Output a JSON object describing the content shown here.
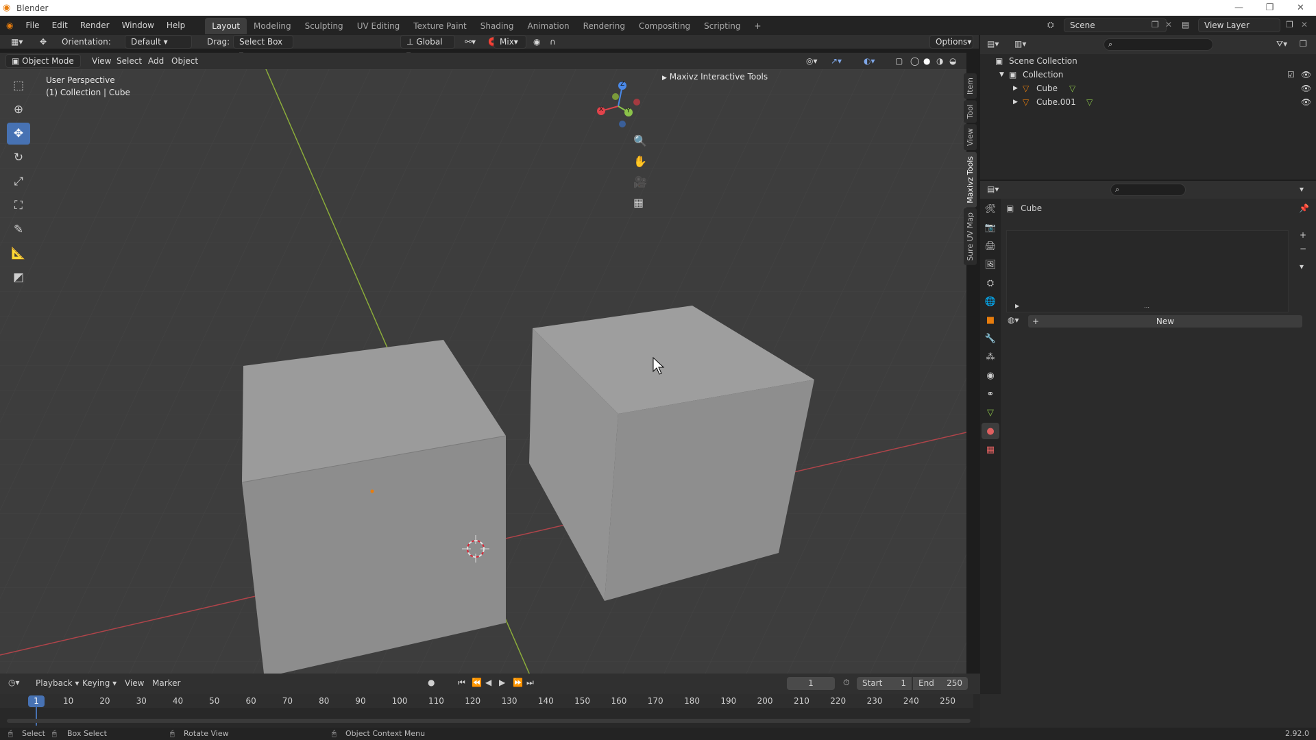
{
  "window": {
    "title": "Blender"
  },
  "menu": [
    "File",
    "Edit",
    "Render",
    "Window",
    "Help"
  ],
  "workspaces": [
    "Layout",
    "Modeling",
    "Sculpting",
    "UV Editing",
    "Texture Paint",
    "Shading",
    "Animation",
    "Rendering",
    "Compositing",
    "Scripting",
    "+"
  ],
  "active_workspace": "Layout",
  "scene": "Scene",
  "view_layer": "View Layer",
  "tool_header": {
    "orientation_label": "Orientation:",
    "orientation_value": "Default",
    "drag_label": "Drag:",
    "drag_value": "Select Box",
    "transform_orientation": "Global",
    "snap_mode": "Mix",
    "options": "Options"
  },
  "viewport_header": {
    "mode": "Object Mode",
    "menus": [
      "View",
      "Select",
      "Add",
      "Object"
    ]
  },
  "viewport": {
    "perspective": "User Perspective",
    "collection_info": "(1) Collection | Cube",
    "panel_label": "Maxivz Interactive Tools",
    "side_tabs": [
      "Item",
      "Tool",
      "View",
      "Maxivz Tools",
      "Sure UV Map"
    ],
    "gizmo": {
      "x": "X",
      "y": "Y",
      "z": "Z"
    }
  },
  "outliner": {
    "root": "Scene Collection",
    "collection": "Collection",
    "items": [
      "Cube",
      "Cube.001"
    ]
  },
  "properties": {
    "object_name": "Cube",
    "new_button": "New"
  },
  "timeline": {
    "menus": [
      "Playback",
      "Keying",
      "View",
      "Marker"
    ],
    "current_frame": "1",
    "start_label": "Start",
    "start_value": "1",
    "end_label": "End",
    "end_value": "250",
    "ticks": [
      "1",
      "10",
      "20",
      "30",
      "40",
      "50",
      "60",
      "70",
      "80",
      "90",
      "100",
      "110",
      "120",
      "130",
      "140",
      "150",
      "160",
      "170",
      "180",
      "190",
      "200",
      "210",
      "220",
      "230",
      "240",
      "250"
    ]
  },
  "statusbar": {
    "select": "Select",
    "box_select": "Box Select",
    "rotate_view": "Rotate View",
    "context_menu": "Object Context Menu",
    "version": "2.92.0"
  },
  "colors": {
    "accent": "#4772b3",
    "x_axis": "#e2434b",
    "y_axis": "#8bc34a",
    "z_axis": "#4a89e8",
    "orange": "#e87d0d"
  }
}
